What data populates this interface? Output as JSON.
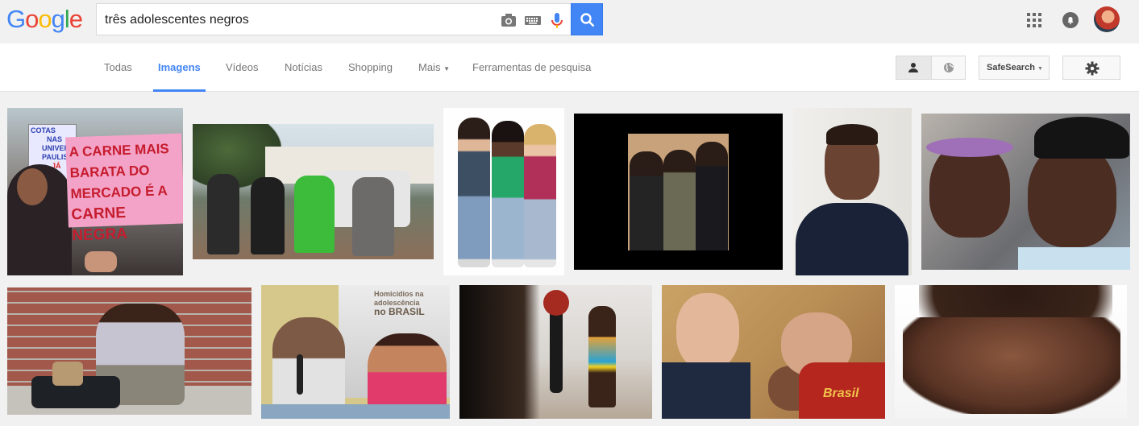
{
  "header": {
    "logo": [
      "G",
      "o",
      "o",
      "g",
      "l",
      "e"
    ],
    "logo_colors": [
      "#4285f4",
      "#ea4335",
      "#fbbc05",
      "#4285f4",
      "#34a853",
      "#ea4335"
    ],
    "search_value": "três adolescentes negros",
    "icons": [
      "camera-icon",
      "keyboard-icon",
      "microphone-icon",
      "search-icon",
      "apps-icon",
      "notifications-icon"
    ]
  },
  "nav": {
    "tabs": [
      "Todas",
      "Imagens",
      "Vídeos",
      "Notícias",
      "Shopping",
      "Mais",
      "Ferramentas de pesquisa"
    ],
    "active_tab": "Imagens",
    "safesearch_label": "SafeSearch"
  },
  "results": {
    "images": [
      {
        "sign_text": [
          "A CARNE MAIS",
          "BARATA DO",
          "MERCADO É A",
          "CARNE NEGRA"
        ],
        "small_sign": [
          "COTAS",
          "NAS",
          "UNIVERS",
          "PAULIS",
          "JÁ"
        ]
      },
      {
        "desc": "police-car-scene"
      },
      {
        "desc": "three-girls"
      },
      {
        "desc": "three-men-black-frame"
      },
      {
        "desc": "mugshot"
      },
      {
        "desc": "two-children"
      },
      {
        "desc": "boy-against-brick-wall"
      },
      {
        "banner_text": [
          "Homicídios na",
          "adolescência",
          "no BRASIL"
        ]
      },
      {
        "desc": "boy-with-gun"
      },
      {
        "shirt_text": "Brasil"
      },
      {
        "desc": "hands-close-up"
      }
    ]
  }
}
